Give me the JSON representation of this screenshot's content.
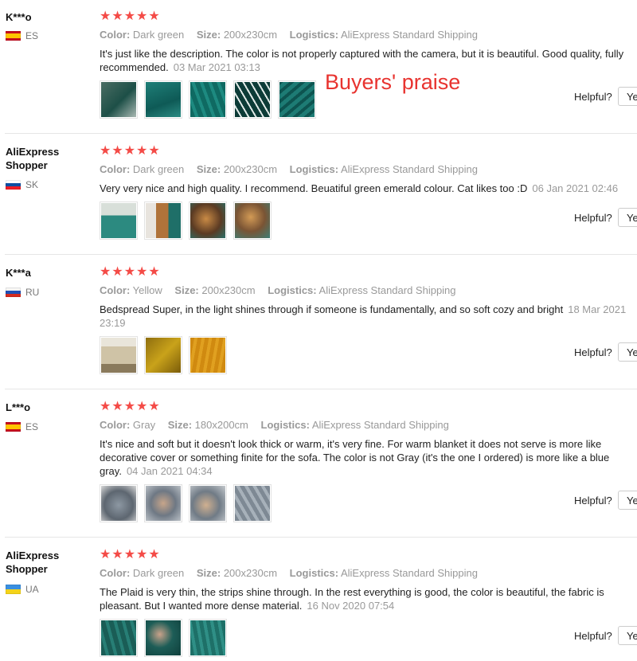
{
  "overlay_text": "Buyers' praise",
  "labels": {
    "color": "Color:",
    "size": "Size:",
    "logistics": "Logistics:",
    "helpful": "Helpful?",
    "yes": "Yes"
  },
  "stars": "★★★★★",
  "reviews": [
    {
      "name": "K***o",
      "country": "ES",
      "color": "Dark green",
      "size": "200x230cm",
      "logistics": "AliExpress Standard Shipping",
      "text": "It's just like the description. The color is not properly captured with the camera, but it is beautiful. Good quality, fully recommended.",
      "date": "03 Mar 2021 03:13"
    },
    {
      "name": "AliExpress Shopper",
      "country": "SK",
      "color": "Dark green",
      "size": "200x230cm",
      "logistics": "AliExpress Standard Shipping",
      "text": "Very very nice and high quality. I recommend. Beuatiful green emerald colour. Cat likes too :D",
      "date": "06 Jan 2021 02:46"
    },
    {
      "name": "K***a",
      "country": "RU",
      "color": "Yellow",
      "size": "200x230cm",
      "logistics": "AliExpress Standard Shipping",
      "text": "Bedspread Super, in the light shines through if someone is fundamentally, and so soft cozy and bright",
      "date": "18 Mar 2021 23:19"
    },
    {
      "name": "L***o",
      "country": "ES",
      "color": "Gray",
      "size": "180x200cm",
      "logistics": "AliExpress Standard Shipping",
      "text": "It's nice and soft but it doesn't look thick or warm, it's very fine. For warm blanket it does not serve is more like decorative cover or something finite for the sofa. The color is not Gray (it's the one I ordered) is more like a blue gray.",
      "date": "04 Jan 2021 04:34"
    },
    {
      "name": "AliExpress Shopper",
      "country": "UA",
      "color": "Dark green",
      "size": "200x230cm",
      "logistics": "AliExpress Standard Shipping",
      "text": "The Plaid is very thin, the strips shine through. In the rest everything is good, the color is beautiful, the fabric is pleasant. But I wanted more dense material.",
      "date": "16 Nov 2020 07:54"
    }
  ],
  "colors": {
    "star": "#f44b47",
    "praise": "#e8332f",
    "teal": "#1b6f68",
    "yellow": "#c9a21a",
    "gray": "#8d98a3"
  }
}
